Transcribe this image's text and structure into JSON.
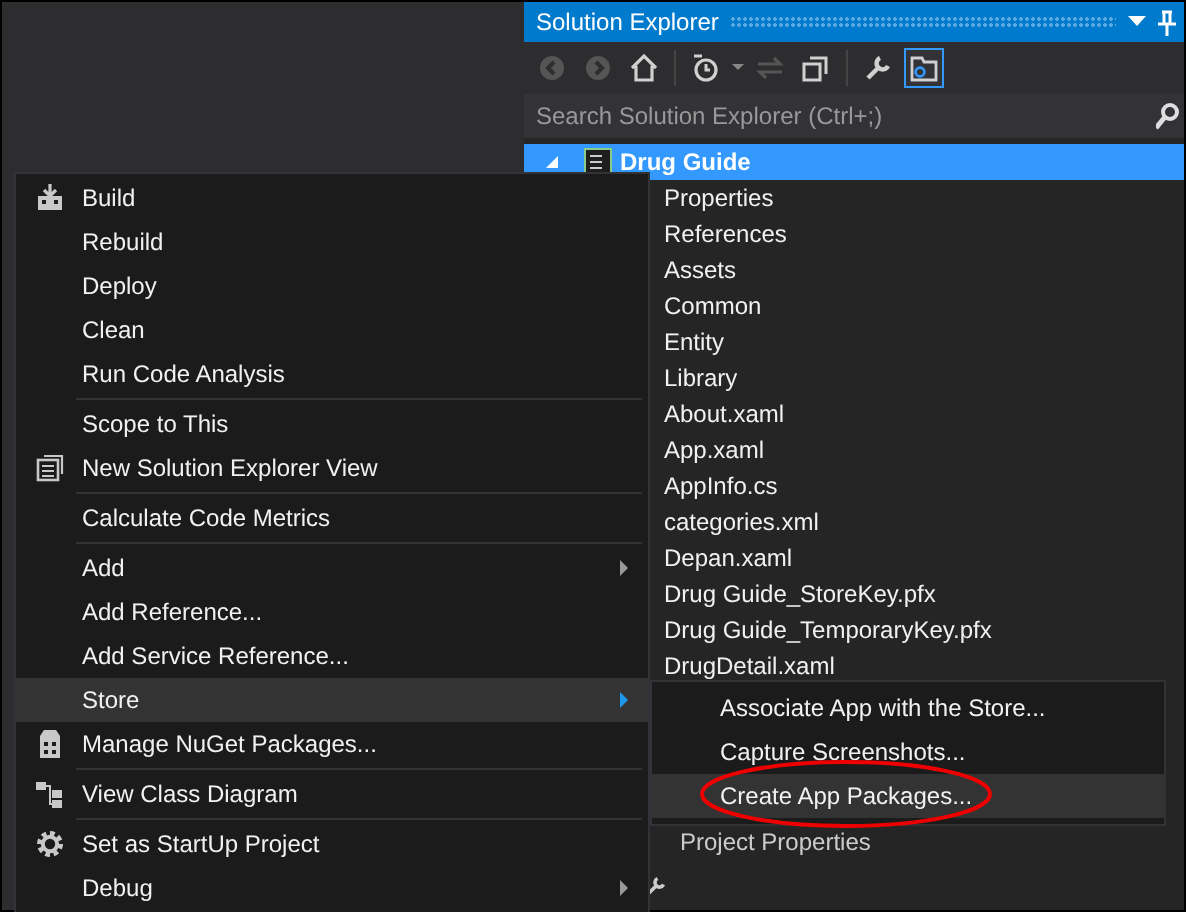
{
  "window": {
    "title": "Solution Explorer"
  },
  "toolbar": [
    {
      "kind": "back",
      "disabled": true,
      "selected": false
    },
    {
      "kind": "forward",
      "disabled": true,
      "selected": false
    },
    {
      "kind": "home",
      "disabled": false,
      "selected": false
    },
    {
      "kind": "separator"
    },
    {
      "kind": "history",
      "disabled": false,
      "selected": false
    },
    {
      "kind": "sync",
      "disabled": true,
      "selected": false
    },
    {
      "kind": "collapse",
      "disabled": false,
      "selected": false
    },
    {
      "kind": "separator"
    },
    {
      "kind": "wrench",
      "disabled": false,
      "selected": false
    },
    {
      "kind": "show-all",
      "disabled": false,
      "selected": true
    }
  ],
  "search": {
    "placeholder": "Search Solution Explorer (Ctrl+;)"
  },
  "tree": [
    {
      "label": "Drug Guide",
      "selected": true,
      "expanded": true,
      "children": [
        {
          "label": "Properties"
        },
        {
          "label": "References"
        },
        {
          "label": "Assets"
        },
        {
          "label": "Common"
        },
        {
          "label": "Entity"
        },
        {
          "label": "Library"
        },
        {
          "label": "About.xaml"
        },
        {
          "label": "App.xaml"
        },
        {
          "label": "AppInfo.cs"
        },
        {
          "label": "categories.xml"
        },
        {
          "label": "Depan.xaml"
        },
        {
          "label": "Drug Guide_StoreKey.pfx"
        },
        {
          "label": "Drug Guide_TemporaryKey.pfx"
        },
        {
          "label": "DrugDetail.xaml"
        }
      ]
    }
  ],
  "properties": {
    "object": "Project Properties"
  },
  "context_menu": [
    {
      "kind": "item",
      "label": "Build",
      "selected": false,
      "submenu": false
    },
    {
      "kind": "item",
      "label": "Rebuild",
      "selected": false,
      "submenu": false
    },
    {
      "kind": "item",
      "label": "Deploy",
      "selected": false,
      "submenu": false
    },
    {
      "kind": "item",
      "label": "Clean",
      "selected": false,
      "submenu": false
    },
    {
      "kind": "item",
      "label": "Run Code Analysis",
      "selected": false,
      "submenu": false
    },
    {
      "kind": "separator"
    },
    {
      "kind": "item",
      "label": "Scope to This",
      "selected": false,
      "submenu": false
    },
    {
      "kind": "item",
      "label": "New Solution Explorer View",
      "selected": false,
      "submenu": false
    },
    {
      "kind": "separator"
    },
    {
      "kind": "item",
      "label": "Calculate Code Metrics",
      "selected": false,
      "submenu": false
    },
    {
      "kind": "separator"
    },
    {
      "kind": "item",
      "label": "Add",
      "selected": false,
      "submenu": true
    },
    {
      "kind": "item",
      "label": "Add Reference...",
      "selected": false,
      "submenu": false
    },
    {
      "kind": "item",
      "label": "Add Service Reference...",
      "selected": false,
      "submenu": false
    },
    {
      "kind": "item",
      "label": "Store",
      "selected": true,
      "submenu": true
    },
    {
      "kind": "item",
      "label": "Manage NuGet Packages...",
      "selected": false,
      "submenu": false
    },
    {
      "kind": "separator"
    },
    {
      "kind": "item",
      "label": "View Class Diagram",
      "selected": false,
      "submenu": false
    },
    {
      "kind": "separator"
    },
    {
      "kind": "item",
      "label": "Set as StartUp Project",
      "selected": false,
      "submenu": false
    },
    {
      "kind": "item",
      "label": "Debug",
      "selected": false,
      "submenu": true
    }
  ],
  "submenu": [
    {
      "label": "Associate App with the Store...",
      "selected": false,
      "circled": false
    },
    {
      "label": "Capture Screenshots...",
      "selected": false,
      "circled": false
    },
    {
      "label": "Create App Packages...",
      "selected": true,
      "circled": true
    }
  ]
}
